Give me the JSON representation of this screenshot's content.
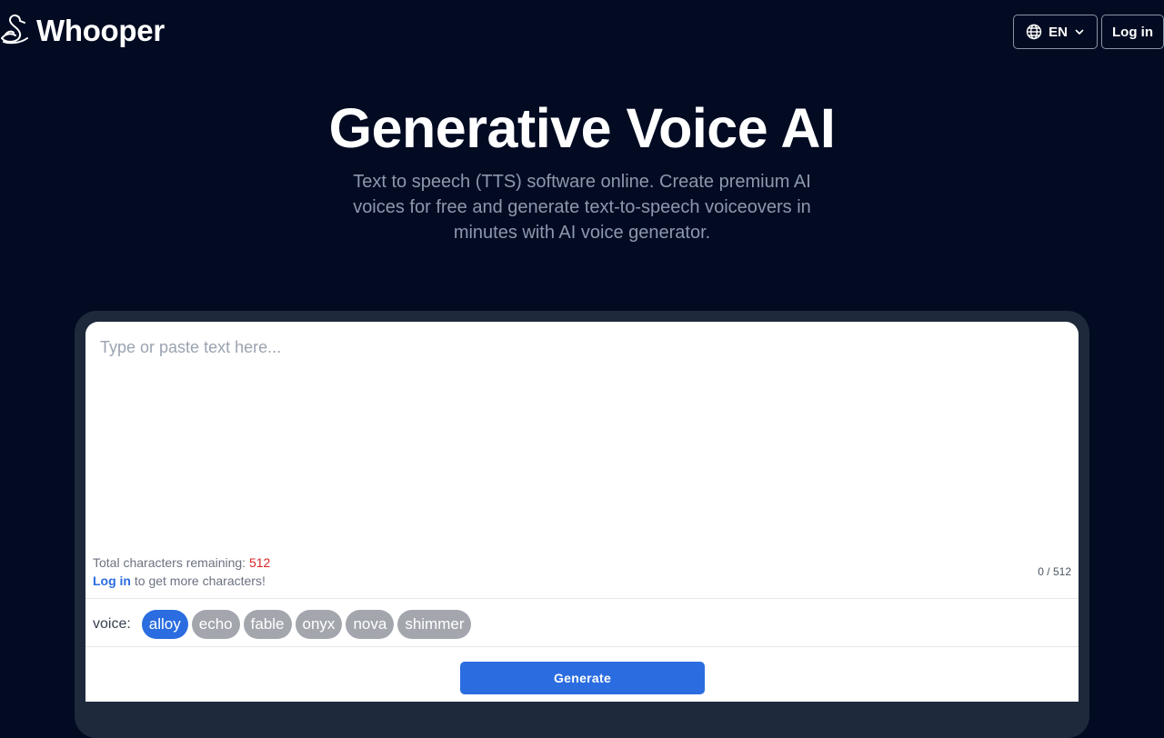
{
  "brand": {
    "name": "Whooper",
    "logo_icon": "swan-icon"
  },
  "header": {
    "language": "EN",
    "language_icon": "globe-icon",
    "login_label": "Log in"
  },
  "hero": {
    "title": "Generative Voice AI",
    "subtitle": "Text to speech (TTS) software online. Create premium AI voices for free and generate text-to-speech voiceovers in minutes with AI voice generator."
  },
  "editor": {
    "placeholder": "Type or paste text here...",
    "value": "",
    "remaining_label": "Total characters remaining: ",
    "remaining_count": "512",
    "login_link": "Log in",
    "login_suffix": " to get more characters!",
    "counter": "0 / 512"
  },
  "voice": {
    "label": "voice:",
    "options": [
      "alloy",
      "echo",
      "fable",
      "onyx",
      "nova",
      "shimmer"
    ],
    "selected": "alloy"
  },
  "generate_label": "Generate",
  "colors": {
    "background": "#020b22",
    "accent": "#2b6de0",
    "chip_inactive": "#a3a6ad",
    "remaining_count": "#dc2626"
  }
}
